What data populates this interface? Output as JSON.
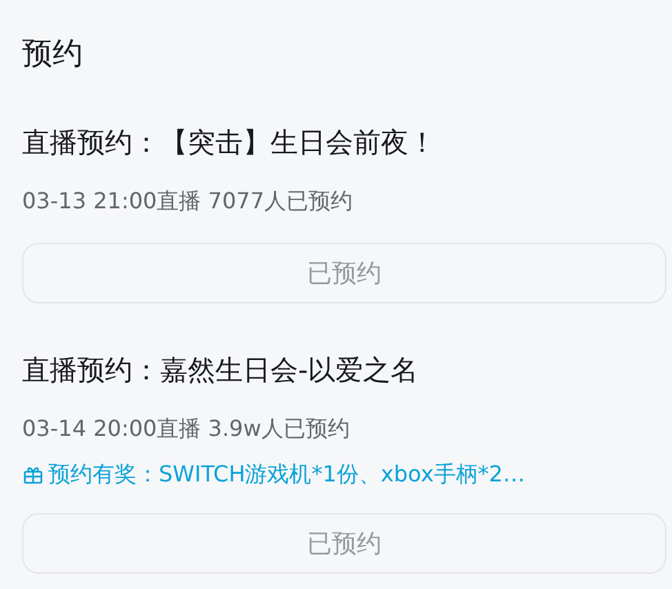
{
  "heading": "预约",
  "items": [
    {
      "title": "直播预约：【突击】生日会前夜！",
      "meta": "03-13 21:00直播 7077人已预约",
      "button": {
        "label": "已预约",
        "disabled": true
      }
    },
    {
      "title": "直播预约：嘉然生日会-以爱之名",
      "meta": "03-14 20:00直播 3.9w人已预约",
      "prize": "预约有奖：SWITCH游戏机*1份、xbox手柄*2…",
      "button": {
        "label": "已预约",
        "disabled": true
      }
    }
  ]
}
